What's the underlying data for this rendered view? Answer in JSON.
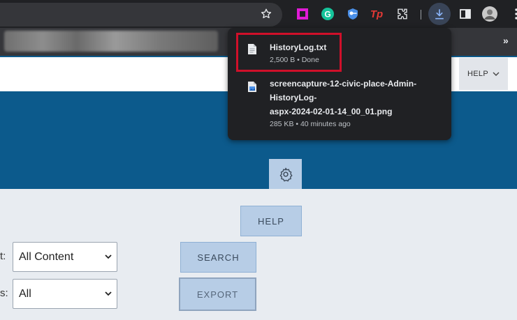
{
  "toolbar": {
    "icons": [
      "star-icon",
      "extension-pink-square-icon",
      "grammarly-icon",
      "password-manager-icon",
      "tp-extension-icon",
      "extensions-puzzle-icon",
      "downloads-icon",
      "side-panel-icon",
      "profile-avatar",
      "more-menu-icon"
    ],
    "tp_label": "Tp",
    "grammarly_label": "G"
  },
  "bookmarks": {
    "overflow": "»"
  },
  "downloads": {
    "items": [
      {
        "name": "HistoryLog.txt",
        "meta": "2,500 B • Done",
        "icon": "text-file-icon"
      },
      {
        "name": "screencapture-12-civic-place-Admin-HistoryLog-aspx-2024-02-01-14_00_01.png",
        "name_lines": [
          "screencapture-12-civic-place-Admin-",
          "HistoryLog-",
          "aspx-2024-02-01-14_00_01.png"
        ],
        "meta": "285 KB • 40 minutes ago",
        "icon": "image-file-icon"
      }
    ]
  },
  "header": {
    "help_menu": "HELP"
  },
  "content": {
    "help_button": "HELP",
    "search_button": "SEARCH",
    "export_button": "EXPORT",
    "content_label": "t:",
    "content_select": "All Content",
    "status_label": "s:",
    "status_select": "All"
  },
  "colors": {
    "banner": "#0c5a8c",
    "button": "#b7cde6",
    "highlight": "#d0102a",
    "panel": "#202124"
  }
}
